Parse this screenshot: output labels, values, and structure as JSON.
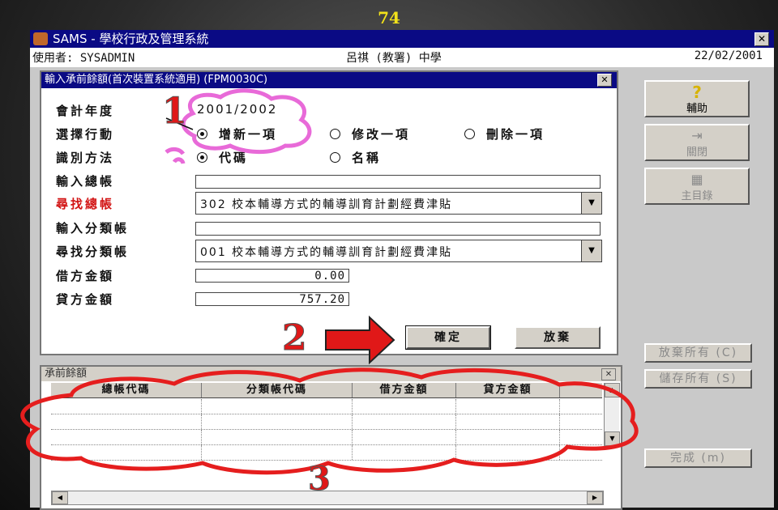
{
  "slide": {
    "page_number": "74"
  },
  "window": {
    "title": "SAMS - 學校行政及管理系統",
    "user_label": "使用者: SYSADMIN",
    "school": "呂祺 (教署) 中學",
    "date": "22/02/2001",
    "close": "✕"
  },
  "dialog": {
    "title": "輸入承前餘額(首次裝置系統適用) (FPM0030C)",
    "close": "✕",
    "labels": {
      "fiscal_year": "會計年度",
      "action": "選擇行動",
      "identify": "識別方法",
      "input_ledger": "輸入總帳",
      "find_ledger": "尋找總帳",
      "input_subledger": "輸入分類帳",
      "find_subledger": "尋找分類帳",
      "debit": "借方金額",
      "credit": "貸方金額"
    },
    "fiscal_year_value": "2001/2002",
    "action_options": [
      "增新一項",
      "修改一項",
      "刪除一項"
    ],
    "action_selected": "增新一項",
    "identify_options": [
      "代碼",
      "名稱"
    ],
    "identify_selected": "代碼",
    "input_ledger_value": "",
    "find_ledger_value": "302 校本輔導方式的輔導訓育計劃經費津貼",
    "input_subledger_value": "",
    "find_subledger_value": "001 校本輔導方式的輔導訓育計劃經費津貼",
    "debit_value": "0.00",
    "credit_value": "757.20",
    "ok_label": "確定",
    "cancel_label": "放棄"
  },
  "annotations": {
    "step1": "1",
    "step2": "2",
    "step3": "3"
  },
  "grid": {
    "title": "承前餘額",
    "close": "✕",
    "columns": [
      "總帳代碼",
      "分類帳代碼",
      "借方金額",
      "貸方金額"
    ]
  },
  "toolbar": {
    "help_label": "輔助",
    "help_icon": "question-icon",
    "close_label": "關閉",
    "close_icon": "exit-door-icon",
    "menu_label": "主目錄",
    "menu_icon": "menu-grid-icon",
    "abandon_all": "放棄所有 (C)",
    "save_all": "儲存所有 (S)",
    "done": "完成 (m)"
  },
  "colors": {
    "accent_title": "#0a0a84",
    "annotation_red": "#e01818",
    "page_num": "#f3e21a",
    "cloud_red": "#e51e1e",
    "cloud_pink": "#e86ad8"
  }
}
